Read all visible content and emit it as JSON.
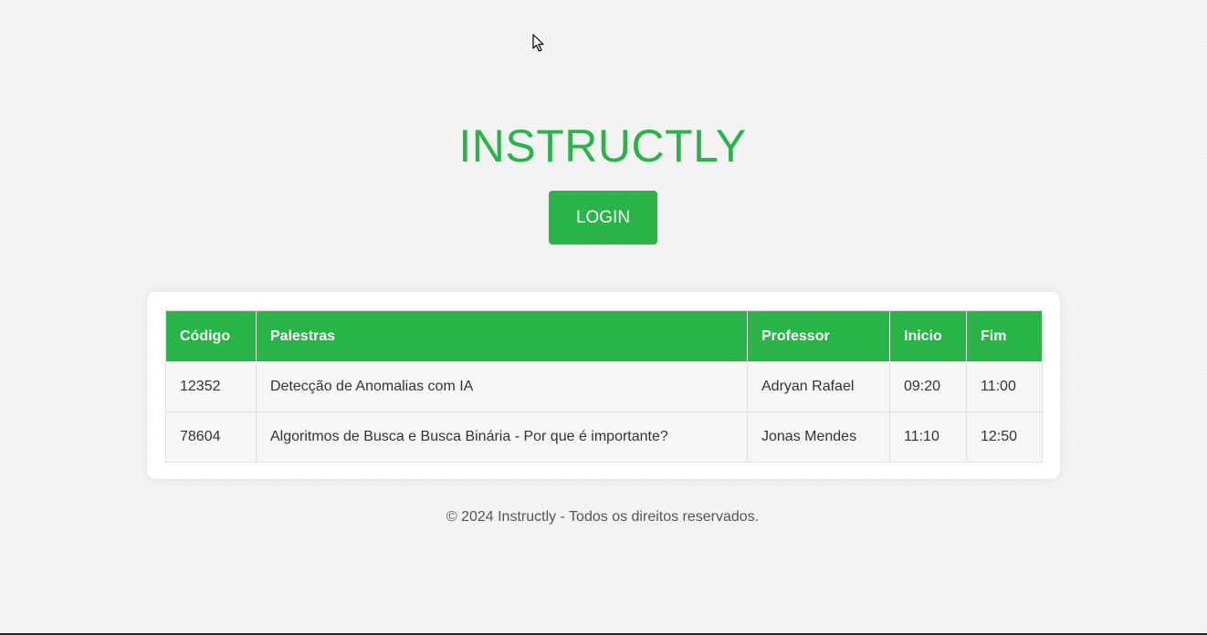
{
  "header": {
    "title": "INSTRUCTLY",
    "login_label": "LOGIN"
  },
  "table": {
    "columns": [
      "Código",
      "Palestras",
      "Professor",
      "Inicio",
      "Fim"
    ],
    "rows": [
      {
        "codigo": "12352",
        "palestra": "Detecção de Anomalias com IA",
        "professor": "Adryan Rafael",
        "inicio": "09:20",
        "fim": "11:00"
      },
      {
        "codigo": "78604",
        "palestra": "Algoritmos de Busca e Busca Binária - Por que é importante?",
        "professor": "Jonas Mendes",
        "inicio": "11:10",
        "fim": "12:50"
      }
    ]
  },
  "footer": {
    "text": "© 2024 Instructly - Todos os direitos reservados."
  },
  "colors": {
    "accent": "#28b446",
    "background": "#f4f4f4",
    "text": "#333333"
  },
  "icons": {
    "cursor": "mouse-pointer-icon"
  }
}
